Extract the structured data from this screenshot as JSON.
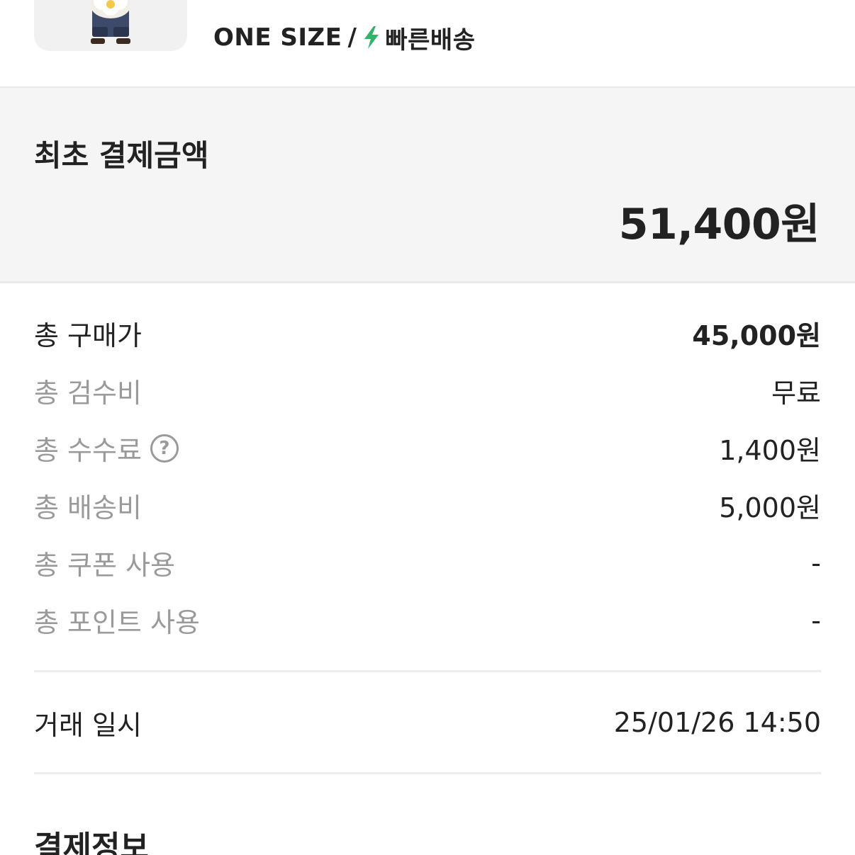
{
  "product": {
    "option_size": "ONE SIZE",
    "option_separator": "/",
    "delivery_label": "빠른배송",
    "bolt_color": "#31b46a"
  },
  "initial_payment": {
    "label": "최초 결제금액",
    "amount": "51,400원"
  },
  "breakdown": [
    {
      "label": "총 구매가",
      "value": "45,000원"
    },
    {
      "label": "총 검수비",
      "value": "무료"
    },
    {
      "label": "총 수수료",
      "value": "1,400원",
      "help_icon": "question-circle-icon"
    },
    {
      "label": "총 배송비",
      "value": "5,000원"
    },
    {
      "label": "총 쿠폰 사용",
      "value": "-"
    },
    {
      "label": "총 포인트 사용",
      "value": "-"
    }
  ],
  "transaction": {
    "label": "거래 일시",
    "value": "25/01/26 14:50"
  },
  "payment_info": {
    "title": "결제정보"
  }
}
